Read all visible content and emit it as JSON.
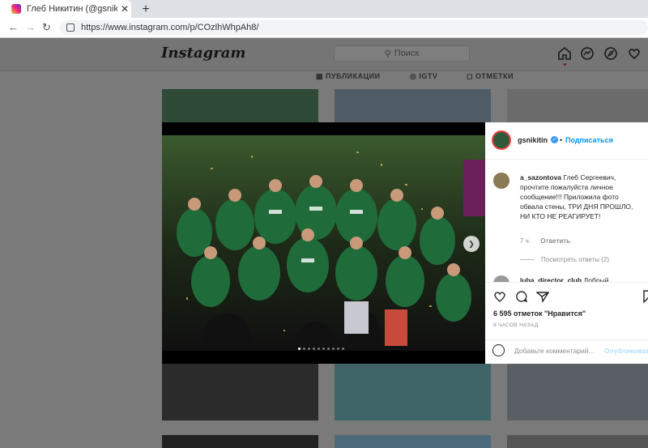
{
  "browser": {
    "tab_title": "Глеб Никитин (@gsnikitin) • Фото",
    "url": "https://www.instagram.com/p/COzlhWhpAh8/"
  },
  "header": {
    "logo": "Instagram",
    "search_placeholder": "Поиск"
  },
  "profile_tabs": [
    "ПУБЛИКАЦИИ",
    "IGTV",
    "ОТМЕТКИ"
  ],
  "post": {
    "username": "gsnikitin",
    "follow_label": "Подписаться",
    "comments": [
      {
        "username": "a_sazontova",
        "text": "Глеб Сергеевич, прочтите пожалуйста личное сообщение!!! Приложила фото обвала стены, ТРИ ДНЯ ПРОШЛО, НИ КТО НЕ РЕАГИРУЕТ!",
        "time": "7 ч.",
        "reply_label": "Ответить",
        "view_replies": "Посмотреть ответы (2)"
      },
      {
        "username": "luba_director_club",
        "text": "Добрый"
      }
    ],
    "likes": "6 595 отметок \"Нравится\"",
    "posted": "8 ЧАСОВ НАЗАД",
    "add_comment_placeholder": "Добавьте комментарий...",
    "post_button": "Опубликовать"
  },
  "colors": {
    "accent": "#0095f6",
    "team_green": "#1f6b3a"
  }
}
